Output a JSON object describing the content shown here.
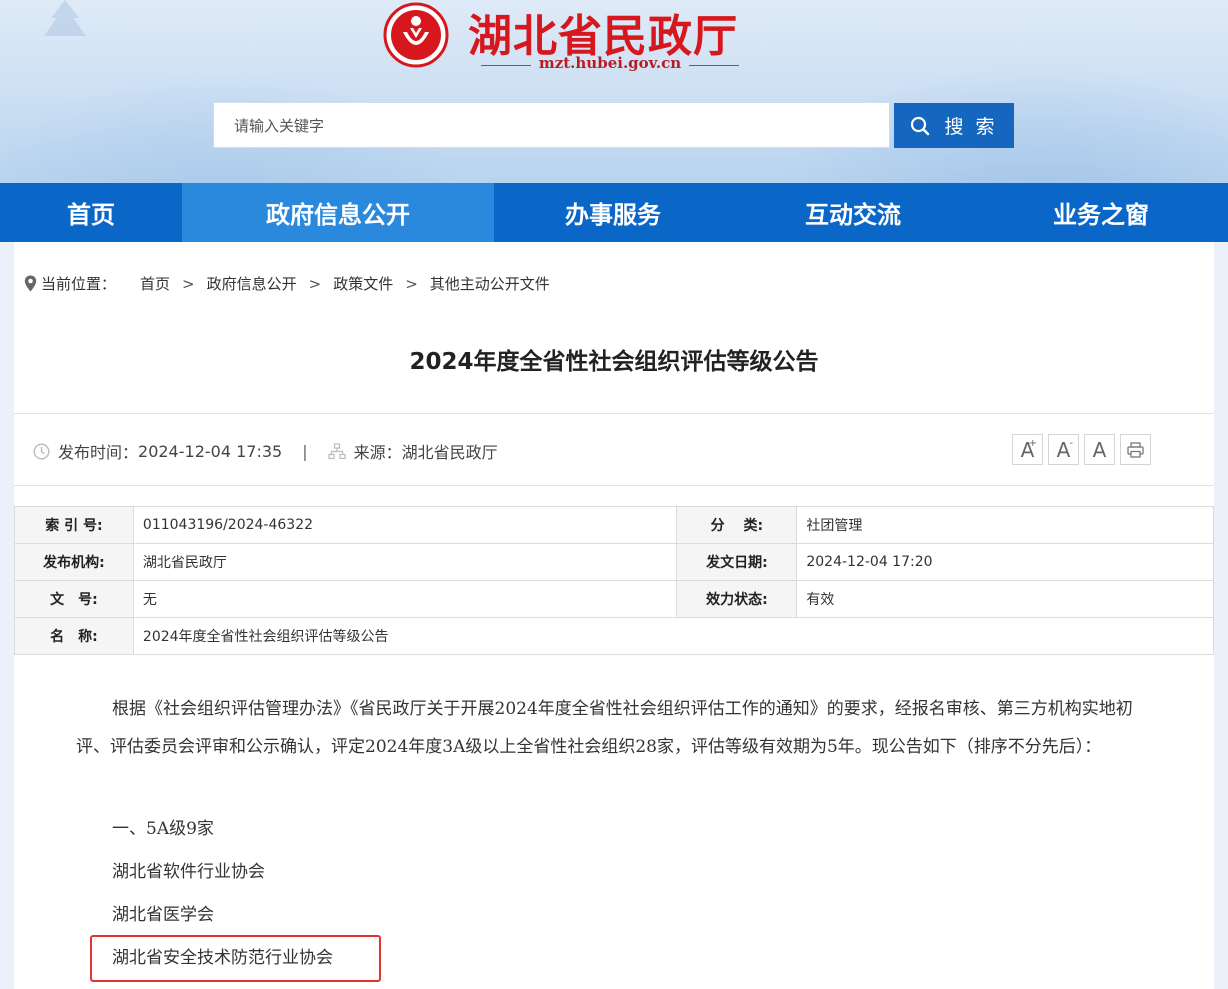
{
  "header": {
    "site_title": "湖北省民政厅",
    "site_domain": "mzt.hubei.gov.cn",
    "search_placeholder": "请输入关键字",
    "search_button": "搜 索"
  },
  "nav": [
    {
      "label": "首页",
      "active": false
    },
    {
      "label": "政府信息公开",
      "active": true
    },
    {
      "label": "办事服务",
      "active": false
    },
    {
      "label": "互动交流",
      "active": false
    },
    {
      "label": "业务之窗",
      "active": false
    }
  ],
  "breadcrumb": {
    "lead": "当前位置：",
    "items": [
      "首页",
      "政府信息公开",
      "政策文件",
      "其他主动公开文件"
    ],
    "separator": ">"
  },
  "article": {
    "title": "2024年度全省性社会组织评估等级公告",
    "publish_label": "发布时间：",
    "publish_time": "2024-12-04 17:35",
    "divider": "|",
    "source_label": "来源：",
    "source": "湖北省民政厅"
  },
  "tools": [
    "A",
    "A",
    "A"
  ],
  "info_table": {
    "index_label": "索 引 号:",
    "index_value": "011043196/2024-46322",
    "category_label": "分　 类:",
    "category_value": "社团管理",
    "org_label": "发布机构:",
    "org_value": "湖北省民政厅",
    "date_label": "发文日期:",
    "date_value": "2024-12-04 17:20",
    "doc_label": "文　号:",
    "doc_value": "无",
    "status_label": "效力状态:",
    "status_value": "有效",
    "name_label": "名　称:",
    "name_value": "2024年度全省性社会组织评估等级公告"
  },
  "content": {
    "paragraph": "根据《社会组织评估管理办法》《省民政厅关于开展2024年度全省性社会组织评估工作的通知》的要求，经报名审核、第三方机构实地初评、评估委员会评审和公示确认，评定2024年度3A级以上全省性社会组织28家，评估等级有效期为5年。现公告如下（排序不分先后）：",
    "section": "一、5A级9家",
    "items": [
      "湖北省软件行业协会",
      "湖北省医学会",
      "湖北省安全技术防范行业协会"
    ]
  },
  "colors": {
    "nav": "#0a67c8",
    "nav_active": "#2a88dd",
    "brand_red": "#d6171e",
    "highlight_border": "#e5322d"
  }
}
